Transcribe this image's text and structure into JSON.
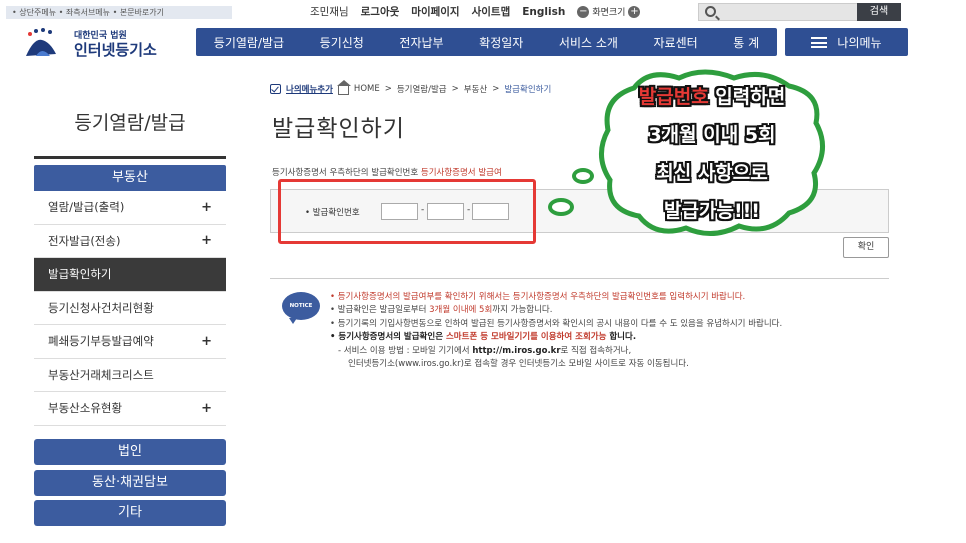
{
  "skip_links": "• 상단주메뉴 • 좌측서브메뉴 • 본문바로가기",
  "util": {
    "user": "조민재님",
    "logout": "로그아웃",
    "mypage": "마이페이지",
    "sitemap": "사이트맵",
    "english": "English",
    "zoom_minus": "−",
    "zoom_label": "화면크기",
    "zoom_plus": "+",
    "search_button": "검색"
  },
  "logo": {
    "small": "대한민국 법원",
    "big": "인터넷등기소"
  },
  "nav": [
    "등기열람/발급",
    "등기신청",
    "전자납부",
    "확정일자",
    "서비스 소개",
    "자료센터",
    "통 계"
  ],
  "my_menu": "나의메뉴",
  "sidebar": {
    "title": "등기열람/발급",
    "section": "부동산",
    "items": [
      {
        "label": "열람/발급(출력)",
        "plus": "+"
      },
      {
        "label": "전자발급(전송)",
        "plus": "+"
      },
      {
        "label": "발급확인하기",
        "plus": ""
      },
      {
        "label": "등기신청사건처리현황",
        "plus": ""
      },
      {
        "label": "폐쇄등기부등발급예약",
        "plus": "+"
      },
      {
        "label": "부동산거래체크리스트",
        "plus": ""
      },
      {
        "label": "부동산소유현황",
        "plus": "+"
      }
    ],
    "categories": [
      "법인",
      "동산·채권담보",
      "기타"
    ]
  },
  "breadcrumb": {
    "add": "나의메뉴추가",
    "home": "HOME",
    "sep": ">",
    "p1": "등기열람/발급",
    "p2": "부동산",
    "current": "발급확인하기"
  },
  "page_title": "발급확인하기",
  "description": {
    "text": "등기사항증명서 우측하단의 발급확인번호 ",
    "link": "등기사항증명서 발급여"
  },
  "form": {
    "label": "• 발급확인번호",
    "dash": "-",
    "confirm": "확인"
  },
  "notice_icon": "NOTICE",
  "notices": {
    "n1": "• 등기사항증명서의 발급여부를 확인하기 위해서는 등기사항증명서 우측하단의 발급확인번호를 입력하시기 바랍니다.",
    "n2_pre": "• 발급확인은 발급일로부터 ",
    "n2_red": "3개월 이내에 5회",
    "n2_post": "까지 가능합니다.",
    "n3": "• 등기기록의 기입사항변동으로 인하여 발급된 등기사항증명서와 확인시의 공시 내용이 다를 수 도 있음을 유념하시기 바랍니다.",
    "n4_pre": "• 등기사항증명서의 발급확인은 ",
    "n4_red": "스마트폰 등 모바일기기를 이용하여 조회가능",
    "n4_post": " 합니다.",
    "n5_pre": "- 서비스 이용 방법 : 모바일 기기에서 ",
    "n5_bold": "http://m.iros.go.kr",
    "n5_post": "로 직접 접속하거나,",
    "n6": "인터넷등기소(www.iros.go.kr)로 접속할 경우 인터넷등기소 모바일 사이트로 자동 이동됩니다."
  },
  "annotation": {
    "l1_red": "발급번호",
    "l1_white": " 입력하면",
    "l2": "3개월 이내 5회",
    "l3": "최신 사항으로",
    "l4": "발급가능!!!"
  },
  "colors": {
    "nav": "#2f4f93",
    "sidebar_head": "#3c5c9f",
    "active": "#3a3a3a",
    "highlight": "#e53935",
    "bubble_border": "#2e9e3e"
  }
}
